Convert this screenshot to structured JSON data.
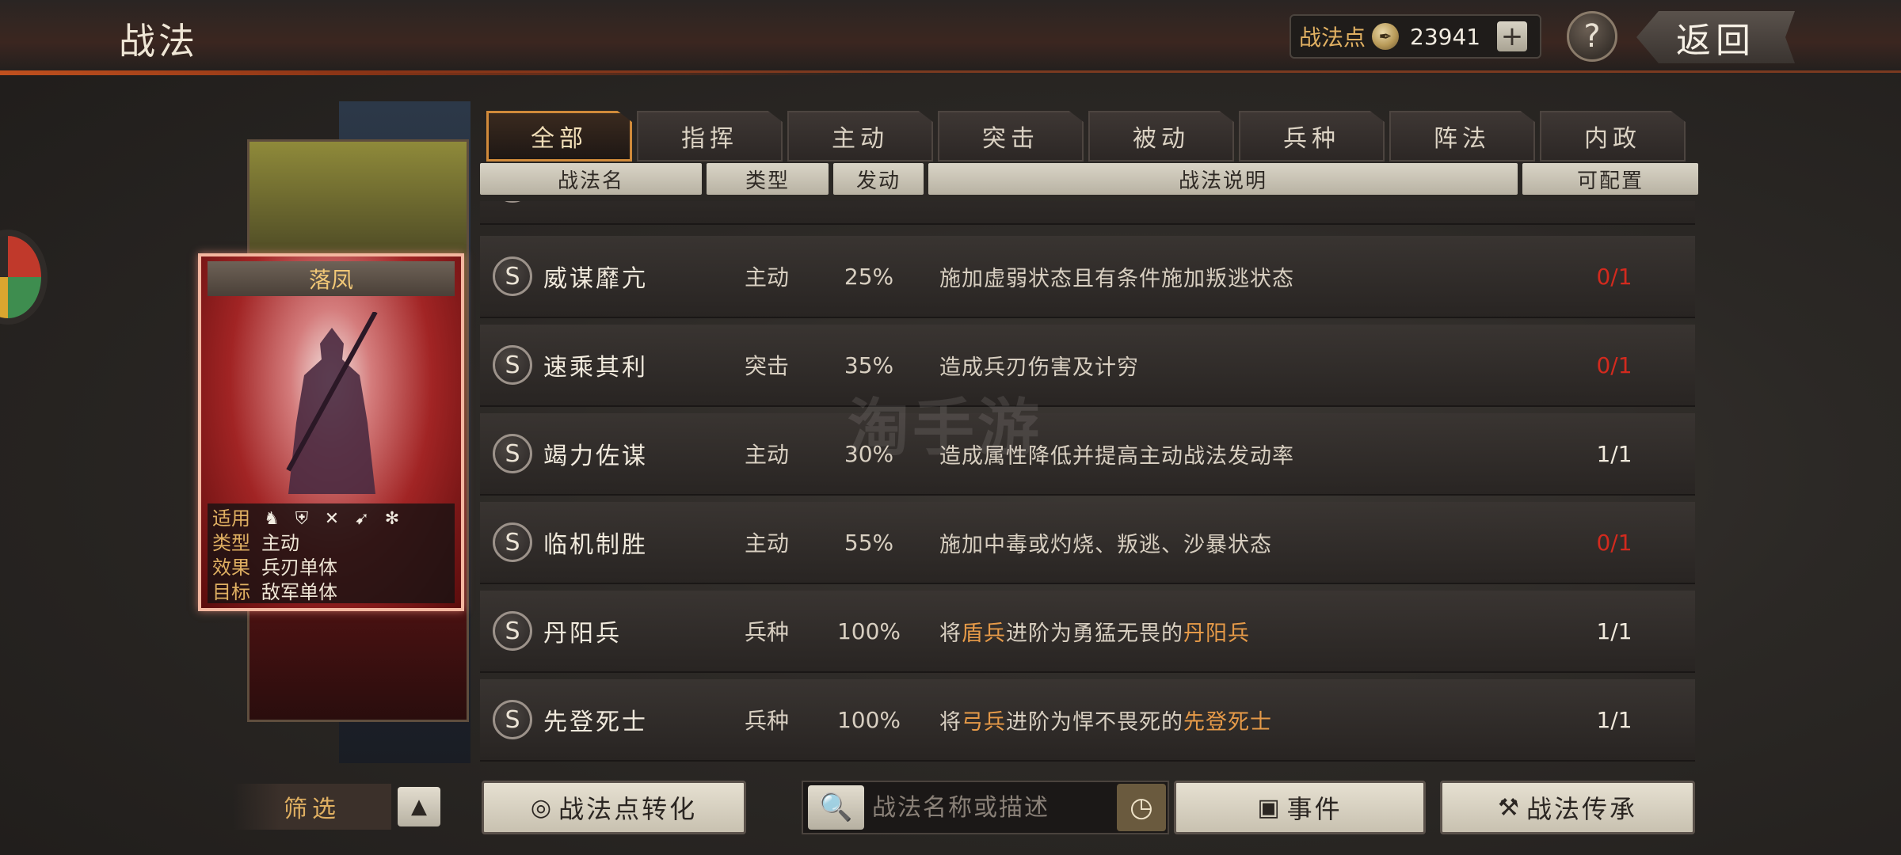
{
  "header": {
    "title": "战法",
    "points_label": "战法点",
    "points_value": "23941",
    "plus_label": "+",
    "help_label": "?",
    "back_label": "返回"
  },
  "tabs": [
    {
      "label": "全部",
      "active": true
    },
    {
      "label": "指挥",
      "active": false
    },
    {
      "label": "主动",
      "active": false
    },
    {
      "label": "突击",
      "active": false
    },
    {
      "label": "被动",
      "active": false
    },
    {
      "label": "兵种",
      "active": false
    },
    {
      "label": "阵法",
      "active": false
    },
    {
      "label": "内政",
      "active": false
    }
  ],
  "table": {
    "headers": [
      "战法名",
      "类型",
      "发动",
      "战法说明",
      "可配置"
    ],
    "rows": [
      {
        "badge": "S",
        "name": "威谋靡亢",
        "type": "主动",
        "rate": "25%",
        "desc": "施加虚弱状态且有条件施加叛逃状态",
        "config": "0/1",
        "config_red": true
      },
      {
        "badge": "S",
        "name": "速乘其利",
        "type": "突击",
        "rate": "35%",
        "desc": "造成兵刃伤害及计穷",
        "config": "0/1",
        "config_red": true
      },
      {
        "badge": "S",
        "name": "竭力佐谋",
        "type": "主动",
        "rate": "30%",
        "desc": "造成属性降低并提高主动战法发动率",
        "config": "1/1",
        "config_red": false
      },
      {
        "badge": "S",
        "name": "临机制胜",
        "type": "主动",
        "rate": "55%",
        "desc": "施加中毒或灼烧、叛逃、沙暴状态",
        "config": "0/1",
        "config_red": true
      },
      {
        "badge": "S",
        "name": "丹阳兵",
        "type": "兵种",
        "rate": "100%",
        "desc_parts": [
          "将",
          "盾兵",
          "进阶为勇猛无畏的",
          "丹阳兵"
        ],
        "config": "1/1",
        "config_red": false
      },
      {
        "badge": "S",
        "name": "先登死士",
        "type": "兵种",
        "rate": "100%",
        "desc_parts": [
          "将",
          "弓兵",
          "进阶为悍不畏死的",
          "先登死士"
        ],
        "config": "1/1",
        "config_red": false
      }
    ]
  },
  "card": {
    "name": "落凤",
    "apply_label": "适用",
    "apply_icons": [
      "cavalry-icon",
      "shield-icon",
      "crossed-bows-icon",
      "spear-icon",
      "wheel-icon"
    ],
    "type_label": "类型",
    "type_value": "主动",
    "effect_label": "效果",
    "effect_value": "兵刃单体",
    "target_label": "目标",
    "target_value": "敌军单体"
  },
  "bottom": {
    "filter_label": "筛选",
    "convert_label": "战法点转化",
    "search_placeholder": "战法名称或描述",
    "event_label": "事件",
    "inherit_label": "战法传承"
  },
  "watermark": "淘手游",
  "colors": {
    "accent": "#d08a3a",
    "config_red": "#d22a1e",
    "highlight": "#e69a48",
    "label_gold": "#e0b062"
  }
}
